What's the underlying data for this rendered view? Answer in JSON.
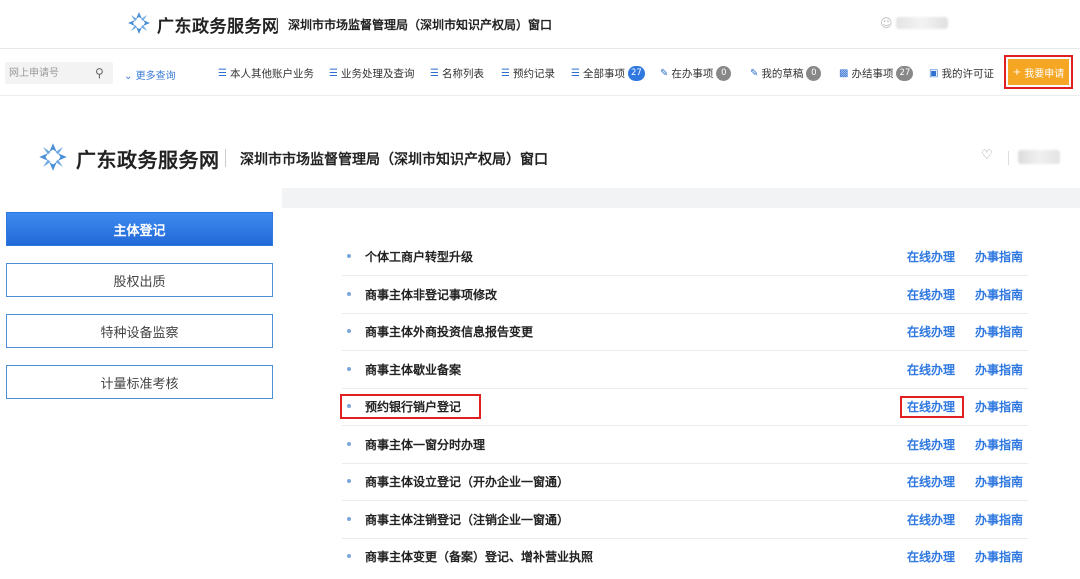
{
  "header1": {
    "brand": "广东政务服务网",
    "window": "深圳市市场监督管理局（深圳市知识产权局）窗口"
  },
  "toolbar": {
    "search_placeholder": "网上申请号",
    "more_query": "更多查询",
    "nav": [
      {
        "label": "本人其他账户业务",
        "icon": "list-icon"
      },
      {
        "label": "业务处理及查询",
        "icon": "list-icon"
      },
      {
        "label": "名称列表",
        "icon": "list-icon"
      },
      {
        "label": "预约记录",
        "icon": "list-icon"
      },
      {
        "label": "全部事项",
        "icon": "list-icon",
        "badge": "27",
        "badge_color": "#2f78e0"
      },
      {
        "label": "在办事项",
        "icon": "edit-icon",
        "badge": "0",
        "badge_color": "#888888"
      },
      {
        "label": "我的草稿",
        "icon": "edit-icon",
        "badge": "0",
        "badge_color": "#888888"
      },
      {
        "label": "办结事项",
        "icon": "briefcase-icon",
        "badge": "27",
        "badge_color": "#888888"
      },
      {
        "label": "我的许可证",
        "icon": "id-card-icon"
      }
    ],
    "apply_label": "我要申请"
  },
  "header2": {
    "brand": "广东政务服务网",
    "window": "深圳市市场监督管理局（深圳市知识产权局）窗口"
  },
  "sidebar": {
    "items": [
      {
        "label": "主体登记",
        "active": true
      },
      {
        "label": "股权出质",
        "active": false
      },
      {
        "label": "特种设备监察",
        "active": false
      },
      {
        "label": "计量标准考核",
        "active": false
      }
    ]
  },
  "services": {
    "online_label": "在线办理",
    "guide_label": "办事指南",
    "items": [
      "个体工商户转型升级",
      "商事主体非登记事项修改",
      "商事主体外商投资信息报告变更",
      "商事主体歇业备案",
      "预约银行销户登记",
      "商事主体一窗分时办理",
      "商事主体设立登记（开办企业一窗通）",
      "商事主体注销登记（注销企业一窗通）",
      "商事主体变更（备案）登记、增补营业执照"
    ]
  },
  "colors": {
    "accent": "#2f78e0",
    "apply_button": "#f5a623",
    "highlight_border": "#e02020"
  }
}
